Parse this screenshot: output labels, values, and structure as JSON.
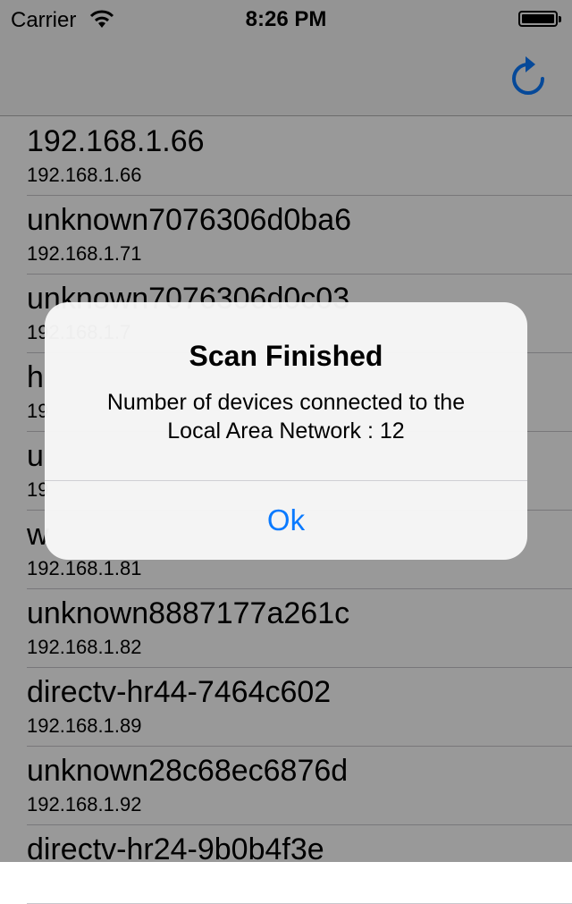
{
  "status_bar": {
    "carrier": "Carrier",
    "time": "8:26 PM"
  },
  "nav_bar": {
    "refresh_icon": "refresh-icon"
  },
  "devices": [
    {
      "name": "192.168.1.66",
      "ip": "192.168.1.66"
    },
    {
      "name": "unknown7076306d0ba6",
      "ip": "192.168.1.71"
    },
    {
      "name": "unknown7076306d0c03",
      "ip": "192.168.1.7"
    },
    {
      "name": "h",
      "ip": "19"
    },
    {
      "name": "u",
      "ip": "19"
    },
    {
      "name": "w",
      "ip": "192.168.1.81"
    },
    {
      "name": "unknown8887177a261c",
      "ip": "192.168.1.82"
    },
    {
      "name": "directv-hr44-7464c602",
      "ip": "192.168.1.89"
    },
    {
      "name": "unknown28c68ec6876d",
      "ip": "192.168.1.92"
    },
    {
      "name": "directv-hr24-9b0b4f3e",
      "ip": ""
    }
  ],
  "alert": {
    "title": "Scan Finished",
    "message_line1": "Number of devices connected to the",
    "message_line2": "Local Area Network : 12",
    "ok_label": "Ok"
  },
  "colors": {
    "accent": "#0a7aff",
    "bar": "#f7f7f7"
  }
}
